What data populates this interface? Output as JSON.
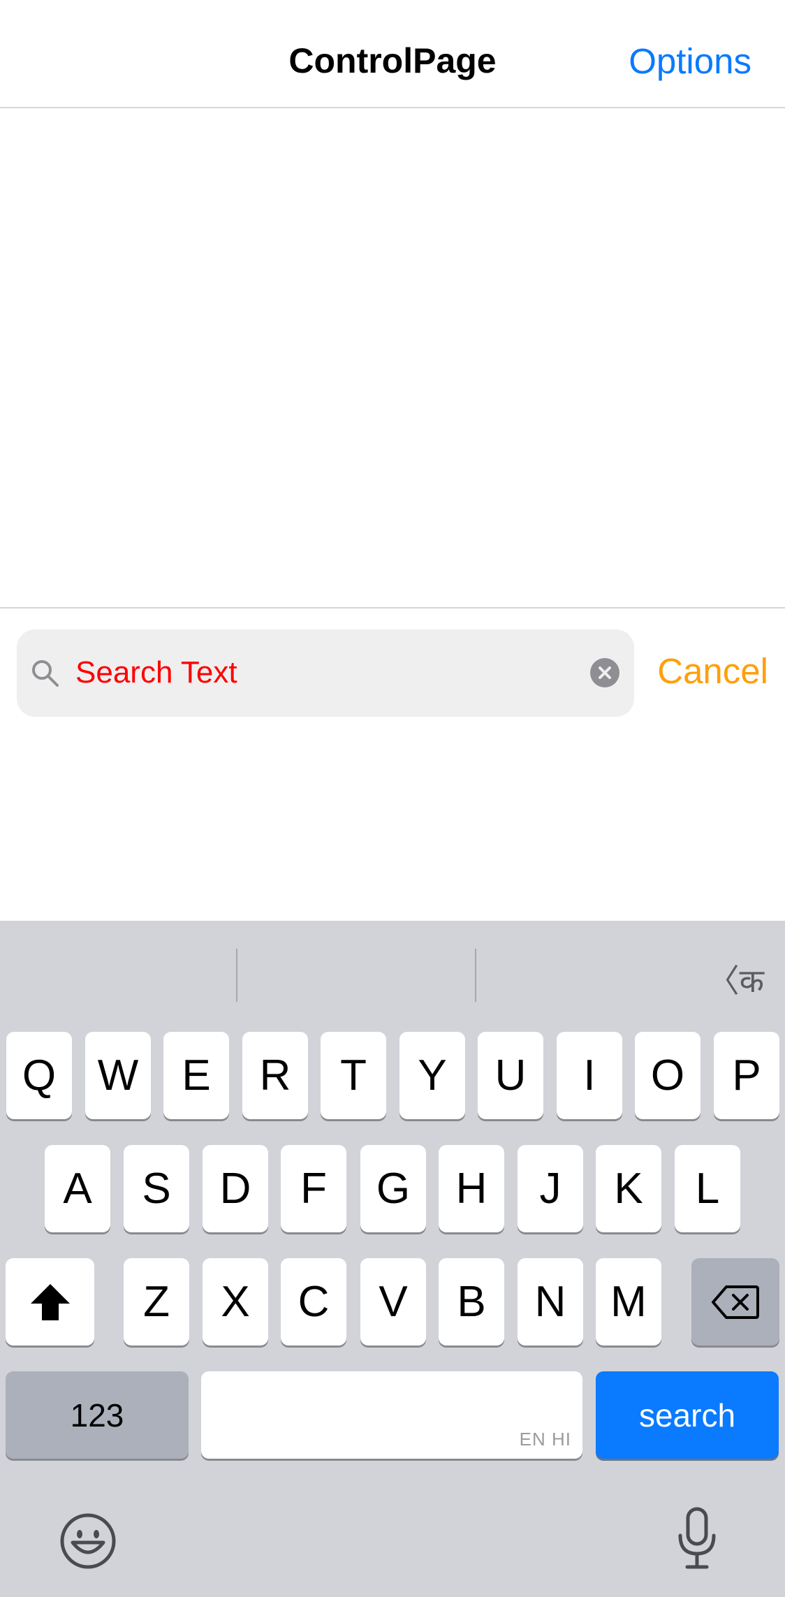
{
  "navbar": {
    "title": "ControlPage",
    "options_label": "Options"
  },
  "search": {
    "placeholder": "Search Text",
    "cancel_label": "Cancel"
  },
  "keyboard": {
    "lang_toggle": "〈क",
    "row1": [
      "Q",
      "W",
      "E",
      "R",
      "T",
      "Y",
      "U",
      "I",
      "O",
      "P"
    ],
    "row2": [
      "A",
      "S",
      "D",
      "F",
      "G",
      "H",
      "J",
      "K",
      "L"
    ],
    "row3": [
      "Z",
      "X",
      "C",
      "V",
      "B",
      "N",
      "M"
    ],
    "numbers_label": "123",
    "space_lang": "EN HI",
    "search_label": "search",
    "emoji_icon": "emoji-icon",
    "mic_icon": "microphone-icon"
  },
  "colors": {
    "accent": "#0a7aff",
    "cancel": "#ff9f0a",
    "search_text": "#ff0000"
  }
}
